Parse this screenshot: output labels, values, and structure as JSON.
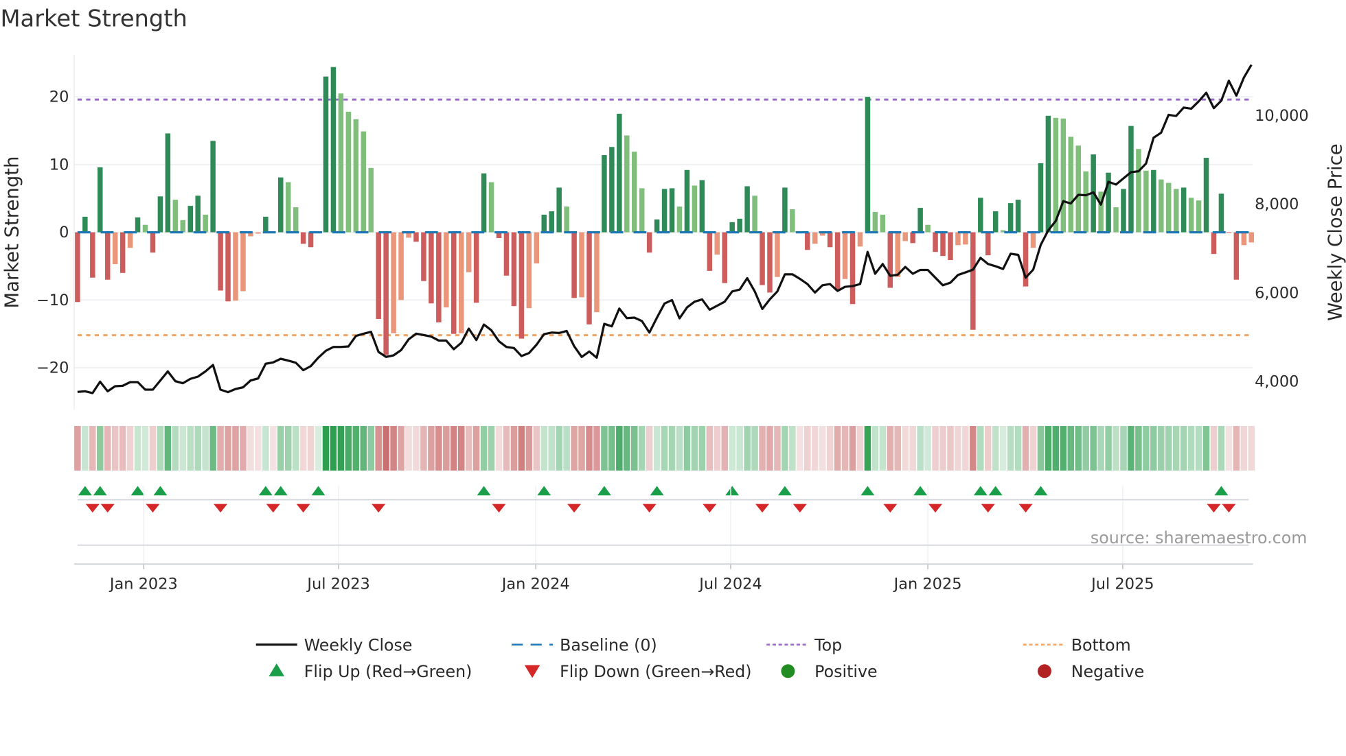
{
  "chart_data": {
    "type": "bar",
    "title": "Market Strength",
    "ylabel": "Market Strength",
    "y2label": "Weekly Close Price",
    "ylim": [
      -26.2,
      26.2
    ],
    "y2lim": [
      3340,
      11355
    ],
    "yticks": [
      {
        "v": 20,
        "label": "20"
      },
      {
        "v": 10,
        "label": "10"
      },
      {
        "v": 0,
        "label": "0"
      },
      {
        "v": -10,
        "label": "−10"
      },
      {
        "v": -20,
        "label": "−20"
      }
    ],
    "y2ticks": [
      {
        "v": 10000,
        "label": "10,000"
      },
      {
        "v": 8000,
        "label": "8,000"
      },
      {
        "v": 6000,
        "label": "6,000"
      },
      {
        "v": 4000,
        "label": "4,000"
      }
    ],
    "xticks": [
      {
        "week": 8.8,
        "label": "Jan 2023"
      },
      {
        "week": 34.7,
        "label": "Jul 2023"
      },
      {
        "week": 60.9,
        "label": "Jan 2024"
      },
      {
        "week": 86.8,
        "label": "Jul 2024"
      },
      {
        "week": 113.0,
        "label": "Jan 2025"
      },
      {
        "week": 138.9,
        "label": "Jul 2025"
      }
    ],
    "top_level": 19.6,
    "bottom_level": -15.2,
    "baseline": 0,
    "grid": true,
    "legend_position": "bottom-center",
    "strength": [
      -10.3,
      2.3,
      -6.7,
      9.6,
      -7.0,
      -4.7,
      -6.0,
      -2.3,
      2.2,
      1.1,
      -3.0,
      5.3,
      14.6,
      4.8,
      1.8,
      3.9,
      5.4,
      2.6,
      13.5,
      -8.6,
      -10.2,
      -10.1,
      -8.7,
      -0.6,
      -0.2,
      2.3,
      -0.1,
      8.1,
      7.4,
      3.7,
      -1.7,
      -2.2,
      0.1,
      23.0,
      24.4,
      20.5,
      17.8,
      16.7,
      14.9,
      9.5,
      -12.8,
      -18.1,
      -14.9,
      -10.0,
      -0.8,
      -1.4,
      -7.2,
      -10.5,
      -13.3,
      -11.1,
      -15.0,
      -14.9,
      -5.9,
      -10.4,
      8.7,
      7.4,
      -0.85,
      -6.4,
      -10.9,
      -15.7,
      -11.2,
      -4.6,
      2.6,
      3.1,
      6.6,
      3.8,
      -9.7,
      -9.6,
      -13.6,
      -11.8,
      11.4,
      12.6,
      17.5,
      14.3,
      11.9,
      6.5,
      -3.0,
      1.9,
      6.4,
      6.5,
      3.8,
      9.2,
      6.9,
      7.7,
      -5.7,
      -3.3,
      -7.5,
      1.5,
      2.0,
      6.8,
      5.4,
      -7.8,
      -8.9,
      -6.6,
      6.6,
      3.4,
      -0.1,
      -2.6,
      -1.7,
      -0.5,
      -2.2,
      -8.6,
      -6.9,
      -10.6,
      -2.1,
      20.0,
      3.0,
      2.6,
      -8.2,
      -6.6,
      -1.3,
      -1.6,
      3.6,
      1.1,
      -2.9,
      -3.5,
      -4.1,
      -1.9,
      -1.8,
      -14.4,
      5.1,
      -3.4,
      3.1,
      0.3,
      4.3,
      4.8,
      -8.0,
      -2.3,
      10.2,
      17.2,
      16.9,
      16.8,
      14.1,
      12.8,
      9.0,
      11.5,
      6.0,
      8.8,
      3.7,
      6.4,
      15.7,
      12.3,
      9.1,
      9.2,
      7.8,
      7.3,
      6.4,
      6.6,
      5.1,
      4.7,
      11.0,
      -3.2,
      5.7,
      -0.1,
      -7.0,
      -1.9,
      -1.5
    ],
    "weekly_close": [
      3742,
      3757,
      3716,
      3974,
      3757,
      3871,
      3881,
      3963,
      3963,
      3793,
      3793,
      4000,
      4206,
      3985,
      3938,
      4036,
      4088,
      4206,
      4351,
      3793,
      3737,
      3809,
      3845,
      4000,
      4046,
      4377,
      4408,
      4490,
      4449,
      4403,
      4232,
      4325,
      4516,
      4671,
      4758,
      4758,
      4768,
      5006,
      5058,
      5099,
      4645,
      4532,
      4568,
      4686,
      4929,
      5058,
      5027,
      4991,
      4903,
      4903,
      4707,
      4851,
      5171,
      4913,
      5264,
      5135,
      4887,
      4758,
      4732,
      4552,
      4619,
      4810,
      5048,
      5083,
      5073,
      5119,
      4774,
      4532,
      4655,
      4516,
      5280,
      5223,
      5625,
      5408,
      5419,
      5341,
      5083,
      5419,
      5739,
      5816,
      5403,
      5651,
      5780,
      5832,
      5600,
      5688,
      5780,
      6012,
      6054,
      6312,
      6012,
      5615,
      5832,
      6012,
      6399,
      6399,
      6296,
      6178,
      5987,
      6152,
      6178,
      6023,
      6116,
      6131,
      6178,
      6905,
      6410,
      6632,
      6364,
      6389,
      6565,
      6410,
      6498,
      6498,
      6322,
      6152,
      6209,
      6384,
      6441,
      6503,
      6771,
      6632,
      6580,
      6518,
      6864,
      6838,
      6322,
      6503,
      7064,
      7390,
      7605,
      8050,
      7998,
      8194,
      8183,
      8250,
      7972,
      8488,
      8426,
      8566,
      8705,
      8726,
      8900,
      9483,
      9597,
      10000,
      9974,
      10165,
      10140,
      10305,
      10500,
      10150,
      10320,
      10770,
      10434,
      10840,
      11130
    ],
    "legend": [
      {
        "key": "weekly-close",
        "label": "Weekly Close"
      },
      {
        "key": "baseline",
        "label": "Baseline (0)"
      },
      {
        "key": "top",
        "label": "Top"
      },
      {
        "key": "bottom",
        "label": "Bottom"
      },
      {
        "key": "flip-up",
        "label": "Flip Up (Red→Green)"
      },
      {
        "key": "flip-down",
        "label": "Flip Down (Green→Red)"
      },
      {
        "key": "positive",
        "label": "Positive"
      },
      {
        "key": "negative",
        "label": "Negative"
      }
    ],
    "annotation": "source: sharemaestro.com"
  },
  "colors": {
    "rising_positive": "#2e8b57",
    "falling_positive": "#7fbf7b",
    "falling_negative": "#cd5c5c",
    "rising_negative": "#e9967a",
    "baseline": "#1f77b4",
    "top": "#9966cc",
    "bottom": "#f4a460",
    "close": "#111111",
    "flip_up": "#1a9e4a",
    "flip_down": "#d62728",
    "positive": "#228b22",
    "negative": "#b22222"
  }
}
